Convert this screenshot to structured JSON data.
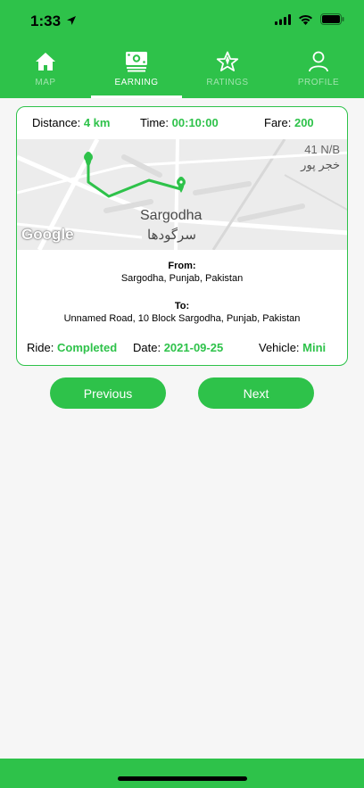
{
  "status_bar": {
    "time": "1:33"
  },
  "tabs": [
    {
      "label": "MAP",
      "icon": "home-icon",
      "active": false
    },
    {
      "label": "EARNING",
      "icon": "money-icon",
      "active": true
    },
    {
      "label": "RATINGS",
      "icon": "star-icon",
      "active": false
    },
    {
      "label": "PROFILE",
      "icon": "user-icon",
      "active": false
    }
  ],
  "ride": {
    "distance_label": "Distance:",
    "distance": "4 km",
    "time_label": "Time:",
    "time": "00:10:00",
    "fare_label": "Fare:",
    "fare": "200",
    "map": {
      "city": "Sargodha",
      "city_urdu": "سرگودھا",
      "area": "41 N/B",
      "area_urdu": "خجر پور",
      "attribution": "Google"
    },
    "from_label": "From:",
    "from": "Sargodha, Punjab, Pakistan",
    "to_label": "To:",
    "to": "Unnamed Road, 10 Block Sargodha, Punjab, Pakistan",
    "status_label": "Ride:",
    "status": "Completed",
    "date_label": "Date:",
    "date": "2021-09-25",
    "vehicle_label": "Vehicle:",
    "vehicle": "Mini"
  },
  "buttons": {
    "previous": "Previous",
    "next": "Next"
  },
  "colors": {
    "accent": "#2ec24a"
  }
}
